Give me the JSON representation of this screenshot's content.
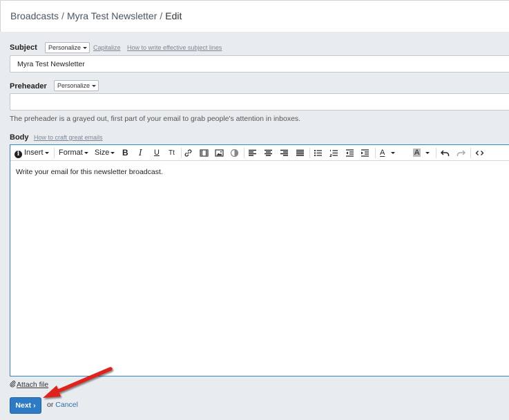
{
  "breadcrumb": {
    "items": [
      "Broadcasts",
      "Myra Test Newsletter",
      "Edit"
    ],
    "separator": "/"
  },
  "subject": {
    "label": "Subject",
    "personalize_label": "Personalize",
    "capitalize_label": "Capitalize",
    "help_label": "How to write effective subject lines",
    "value": "Myra Test Newsletter"
  },
  "preheader": {
    "label": "Preheader",
    "personalize_label": "Personalize",
    "value": "",
    "hint": "The preheader is a grayed out, first part of your email to grab people's attention in inboxes."
  },
  "body": {
    "label": "Body",
    "help_label": "How to craft great emails",
    "content": "Write your email for this newsletter broadcast.",
    "toolbar": {
      "insert_label": "Insert",
      "format_label": "Format",
      "size_label": "Size",
      "bold_label": "B",
      "italic_label": "I",
      "underline_label": "U",
      "clear_format_label": "Tt",
      "text_color_label": "A",
      "bg_color_label": "A",
      "icons": [
        "info-icon",
        "link-icon",
        "video-icon",
        "image-icon",
        "contrast-icon",
        "align-left-icon",
        "align-center-icon",
        "align-right-icon",
        "align-justify-icon",
        "bullet-list-icon",
        "numbered-list-icon",
        "outdent-icon",
        "indent-icon",
        "undo-icon",
        "redo-icon",
        "code-view-icon"
      ]
    }
  },
  "attach": {
    "label": "Attach file",
    "icon": "paperclip-icon"
  },
  "actions": {
    "next_label": "Next ›",
    "or_label": "or",
    "cancel_label": "Cancel"
  },
  "colors": {
    "primary": "#2d7bc4",
    "editor_border": "#2f86c8",
    "annotation_arrow": "#e0201b"
  }
}
